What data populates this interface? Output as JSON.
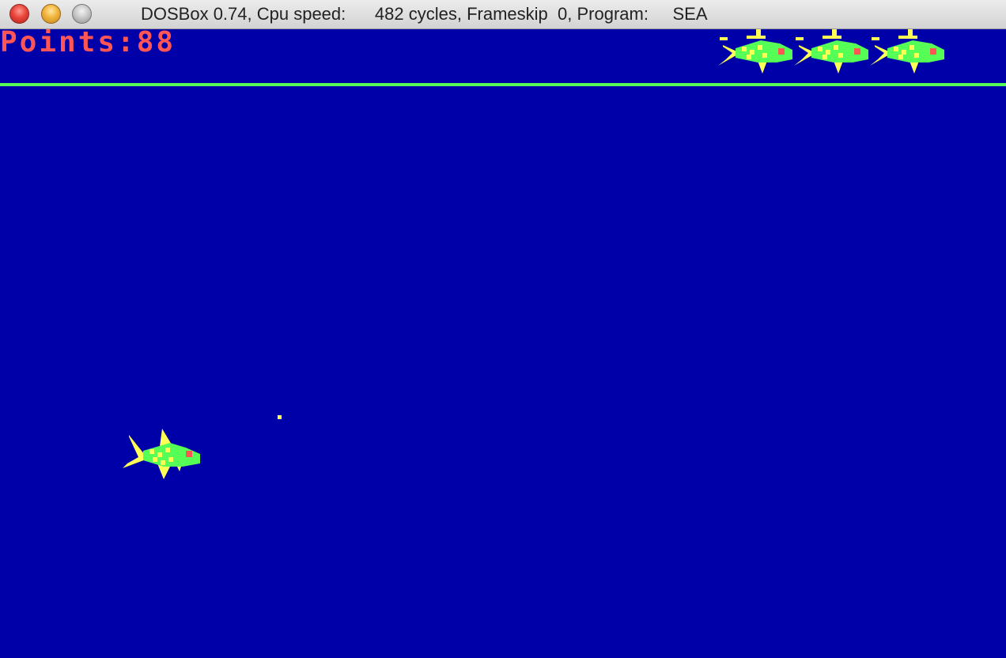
{
  "window": {
    "title": "DOSBox 0.74, Cpu speed:      482 cycles, Frameskip  0, Program:     SEA"
  },
  "hud": {
    "score_text": "Points:88",
    "lives": 3
  },
  "icons": {
    "close": "close-button-icon",
    "minimize": "minimize-button-icon",
    "zoom": "zoom-button-icon",
    "life": "submarine-fish-icon",
    "player": "player-fish-icon",
    "bullet": "bullet-dot"
  },
  "colors": {
    "sea": "#0000a8",
    "score": "#ff5555",
    "waterline": "#55ff55",
    "fish_body": "#55ff55",
    "fish_fin": "#ffff55",
    "fish_eye": "#ff5555",
    "bullet": "#ffff55"
  }
}
